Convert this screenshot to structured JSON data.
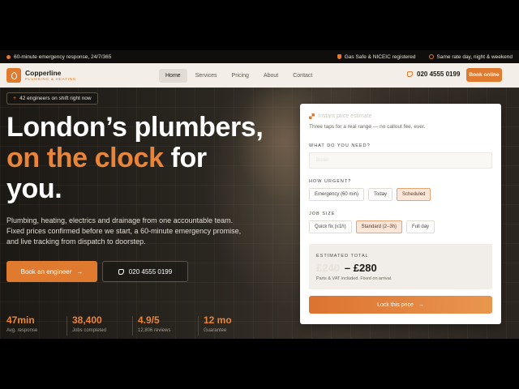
{
  "topbar": {
    "left_text": "60-minute emergency response, 24/7/365",
    "right_items": [
      {
        "icon": "shield-icon",
        "text": "Gas Safe & NICEIC registered"
      },
      {
        "icon": "clock-icon",
        "text": "Same rate day, night & weekend"
      }
    ]
  },
  "brand": {
    "name": "Copperline",
    "tagline": "PLUMBING & HEATING",
    "icon": "drop-icon",
    "accent_color": "#e07a2e"
  },
  "nav": {
    "links": [
      "Home",
      "Services",
      "Pricing",
      "About",
      "Contact"
    ],
    "active": "Home",
    "phone": "020 4555 0199",
    "cta": "Book online"
  },
  "hero": {
    "badge": "42 engineers on shift right now",
    "headline_line1": "London’s plumbers,",
    "headline_accent": "on the clock",
    "headline_rest": "for",
    "headline_line3": "you.",
    "lede": "Plumbing, heating, electrics and drainage from one accountable team. Fixed prices confirmed before we start, a 60-minute emergency promise, and live tracking from dispatch to doorstep.",
    "primary_cta": "Book an engineer",
    "secondary_cta": "020 4555 0199",
    "stats": [
      {
        "value": "47min",
        "label": "Avg. response"
      },
      {
        "value": "38,400",
        "label": "Jobs completed"
      },
      {
        "value": "4.9/5",
        "label": "12,806 reviews"
      },
      {
        "value": "12 mo",
        "label": "Guarantee"
      }
    ]
  },
  "quote": {
    "heading": "Instant price estimate",
    "subheading": "Three taps for a real range — no callout fee, ever.",
    "need_label": "WHAT DO YOU NEED?",
    "need_placeholder": "Boiler",
    "urgency_label": "HOW URGENT?",
    "urgency_options": [
      "Emergency (60 min)",
      "Today",
      "Scheduled"
    ],
    "urgency_selected": "Scheduled",
    "size_label": "JOB SIZE",
    "size_options": [
      "Quick fix (≤1h)",
      "Standard (2–3h)",
      "Full day"
    ],
    "size_selected": "Standard (2–3h)",
    "total_label": "ESTIMATED TOTAL",
    "total_from": "£240",
    "total_to": "– £280",
    "total_note": "Parts & VAT included. Fixed on arrival.",
    "cta": "Lock this price"
  }
}
